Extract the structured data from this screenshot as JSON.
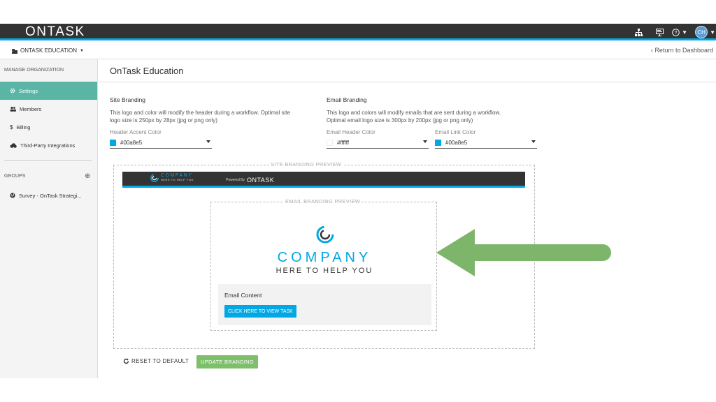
{
  "colors": {
    "accent": "#00a8e5",
    "header_bg": "#333333",
    "sidebar_active": "#5ab5a5",
    "update_button": "#7dbf6a",
    "arrow": "#7db56a"
  },
  "topbar": {
    "logo": "ONTASK",
    "avatar_initials": "CH",
    "icons": [
      "org-chart-icon",
      "presentation-icon",
      "help-icon"
    ]
  },
  "orgbar": {
    "org_name": "ONTASK EDUCATION",
    "return_link": "Return to Dashboard"
  },
  "sidebar": {
    "manage_heading": "MANAGE ORGANIZATION",
    "items": [
      {
        "label": "Settings",
        "icon": "gear-icon",
        "active": true
      },
      {
        "label": "Members",
        "icon": "users-icon",
        "active": false
      },
      {
        "label": "Billing",
        "icon": "dollar-icon",
        "active": false
      },
      {
        "label": "Third-Party Integrations",
        "icon": "cloud-icon",
        "active": false
      }
    ],
    "groups_heading": "GROUPS",
    "groups": [
      {
        "label": "Survey - OnTask Strategi..."
      }
    ]
  },
  "main": {
    "title": "OnTask Education",
    "site_branding": {
      "title": "Site Branding",
      "desc_line1": "This logo and color will modify the header during a workflow. Optimal site",
      "desc_line2": "logo size is 250px by 28px (jpg or png only)",
      "header_accent_label": "Header Accent Color",
      "header_accent_value": "#00a8e5"
    },
    "email_branding": {
      "title": "Email Branding",
      "desc_line1": "This logo and colors will modify emails that are sent during a workflow.",
      "desc_line2": "Optimal email logo size is 300px by 200px (jpg or png only)",
      "header_color_label": "Email Header Color",
      "header_color_value": "#ffffff",
      "link_color_label": "Email Link Color",
      "link_color_value": "#00a8e5"
    },
    "site_preview_legend": "SITE BRANDING PREVIEW",
    "email_preview_legend": "EMAIL BRANDING PREVIEW",
    "site_preview": {
      "company": "COMPANY",
      "tagline": "HERE TO HELP YOU",
      "powered_by": "Powered By",
      "powered_logo": "ONTASK"
    },
    "email_preview": {
      "company": "COMPANY",
      "tagline": "HERE TO HELP YOU",
      "content_label": "Email Content",
      "cta_label": "CLICK HERE TO VIEW TASK"
    },
    "reset_label": "RESET TO DEFAULT",
    "update_label": "UPDATE BRANDING"
  }
}
